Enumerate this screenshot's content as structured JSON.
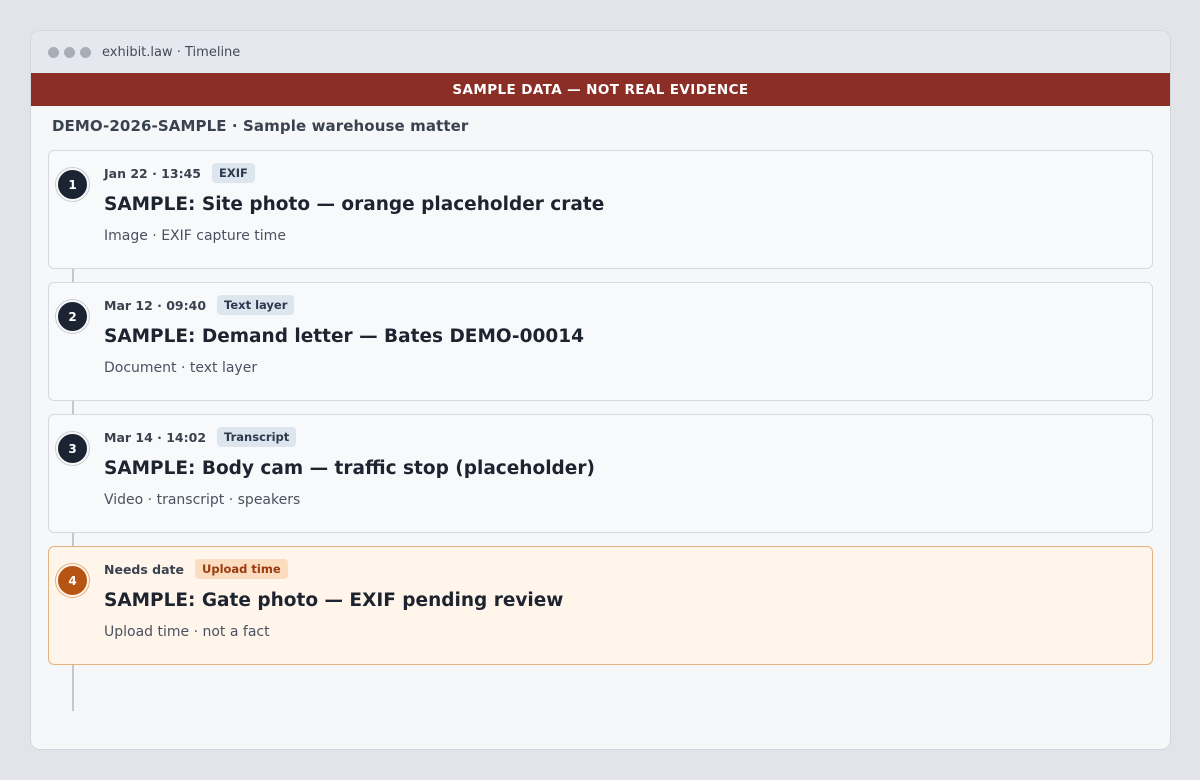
{
  "window": {
    "title": "exhibit.law · Timeline"
  },
  "banner": {
    "text": "SAMPLE DATA — NOT REAL EVIDENCE",
    "color": "#8b2e26"
  },
  "matter": {
    "label": "DEMO-2026-SAMPLE · Sample warehouse matter"
  },
  "timeline": {
    "items": [
      {
        "number": "1",
        "date": "Jan 22 · 13:45",
        "badge": "EXIF",
        "title": "SAMPLE: Site photo — orange placeholder crate",
        "subtitle": "Image · EXIF capture time",
        "status": "dated"
      },
      {
        "number": "2",
        "date": "Mar 12 · 09:40",
        "badge": "Text layer",
        "title": "SAMPLE: Demand letter — Bates DEMO-00014",
        "subtitle": "Document · text layer",
        "status": "dated"
      },
      {
        "number": "3",
        "date": "Mar 14 · 14:02",
        "badge": "Transcript",
        "title": "SAMPLE: Body cam — traffic stop (placeholder)",
        "subtitle": "Video · transcript · speakers",
        "status": "dated"
      },
      {
        "number": "4",
        "date": "Needs date",
        "badge": "Upload time",
        "title": "SAMPLE: Gate photo — EXIF pending review",
        "subtitle": "Upload time · not a fact",
        "status": "needs-date"
      }
    ]
  },
  "colors": {
    "dated_marker": "#1c2433",
    "warning_marker": "#b85413",
    "warning_background": "#fff5eb"
  }
}
